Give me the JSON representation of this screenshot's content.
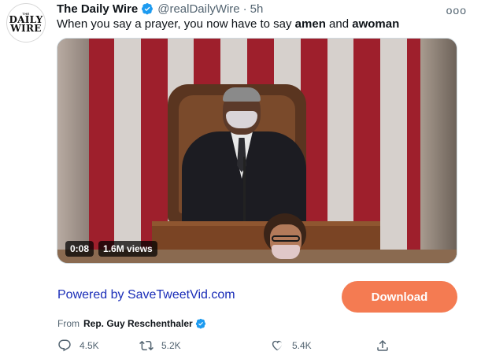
{
  "tweet": {
    "author_name": "The Daily Wire",
    "handle": "@realDailyWire",
    "separator": "·",
    "time": "5h",
    "more_label": "ooo",
    "text_before": "When you say a prayer, you now have to say ",
    "text_bold_1": "amen",
    "text_middle": " and ",
    "text_bold_2": "awoman",
    "avatar": {
      "tiny_text": "THE",
      "line1": "DAILY",
      "line2": "WIRE"
    }
  },
  "video": {
    "duration": "0:08",
    "views": "1.6M views"
  },
  "promo": {
    "powered_by": "Powered by SaveTweetVid.com",
    "download_label": "Download"
  },
  "source": {
    "from_label": "From",
    "from_name": "Rep. Guy Reschenthaler"
  },
  "actions": {
    "replies": "4.5K",
    "retweets": "5.2K",
    "likes": "5.4K"
  },
  "colors": {
    "verified": "#1d9bf0",
    "download_bg": "#f47b52",
    "link": "#1a2db8",
    "muted": "#536471"
  },
  "icons": [
    "verified-badge-icon",
    "more-options-icon",
    "reply-icon",
    "retweet-icon",
    "like-icon",
    "share-icon"
  ]
}
